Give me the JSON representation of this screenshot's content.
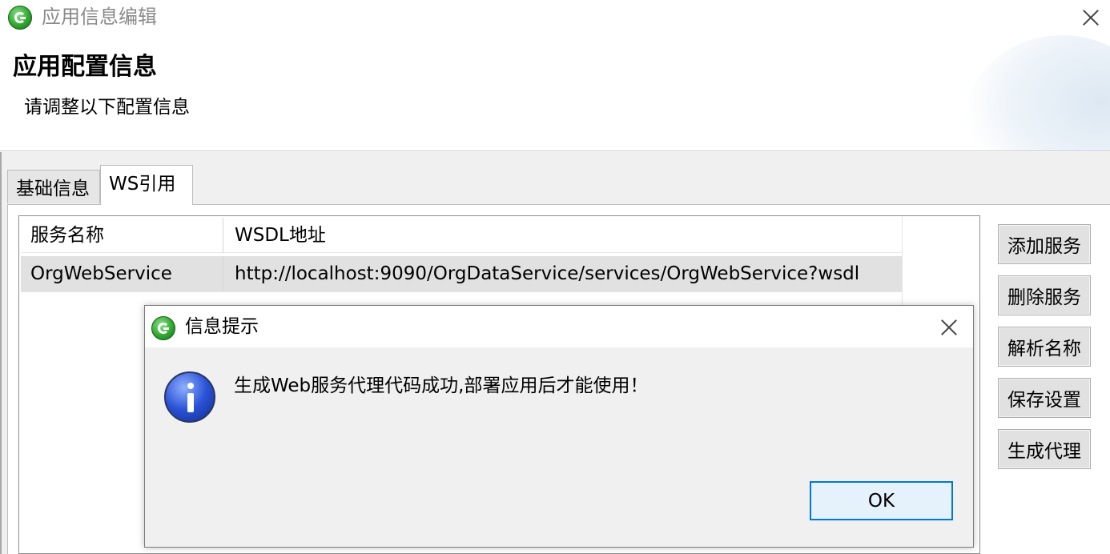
{
  "window": {
    "title": "应用信息编辑",
    "header_title": "应用配置信息",
    "header_subtitle": "请调整以下配置信息"
  },
  "tabs": [
    {
      "label": "基础信息",
      "active": false
    },
    {
      "label": "WS引用",
      "active": true
    }
  ],
  "table": {
    "columns": [
      "服务名称",
      "WSDL地址"
    ],
    "rows": [
      {
        "name": "OrgWebService",
        "wsdl": "http://localhost:9090/OrgDataService/services/OrgWebService?wsdl",
        "selected": true
      }
    ]
  },
  "buttons": {
    "add_service": "添加服务",
    "delete_service": "删除服务",
    "parse_name": "解析名称",
    "save_settings": "保存设置",
    "generate_proxy": "生成代理"
  },
  "dialog": {
    "title": "信息提示",
    "message": "生成Web服务代理代码成功,部署应用后才能使用！",
    "ok_label": "OK",
    "icon": "info-icon"
  },
  "icons": {
    "app": "app-logo-icon",
    "close": "close-icon"
  },
  "colors": {
    "selected_row": "#e1e1e1",
    "ok_border": "#0078d7",
    "ok_background": "#e5f1fb"
  }
}
